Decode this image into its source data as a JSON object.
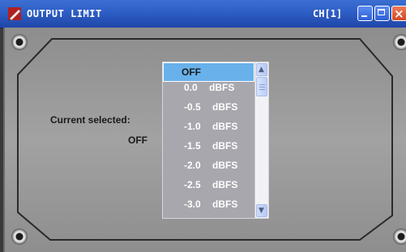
{
  "window": {
    "title": "OUTPUT LIMIT",
    "channel": "CH[1]",
    "buttons": {
      "minimize": "minimize",
      "maximize": "maximize",
      "close": "×"
    }
  },
  "panel": {
    "current_label": "Current selected:",
    "current_value": "OFF"
  },
  "listbox": {
    "items": [
      "OFF",
      "0.0 dBFS",
      "-0.5 dBFS",
      "-1.0 dBFS",
      "-1.5 dBFS",
      "-2.0 dBFS",
      "-2.5 dBFS",
      "-3.0 dBFS"
    ],
    "selected_index": 0,
    "scroll_up_glyph": "▲",
    "scroll_down_glyph": "▼"
  },
  "colors": {
    "titlebar": "#2f60c7",
    "selection": "#69b1ea",
    "panel": "#9a9a9a"
  }
}
